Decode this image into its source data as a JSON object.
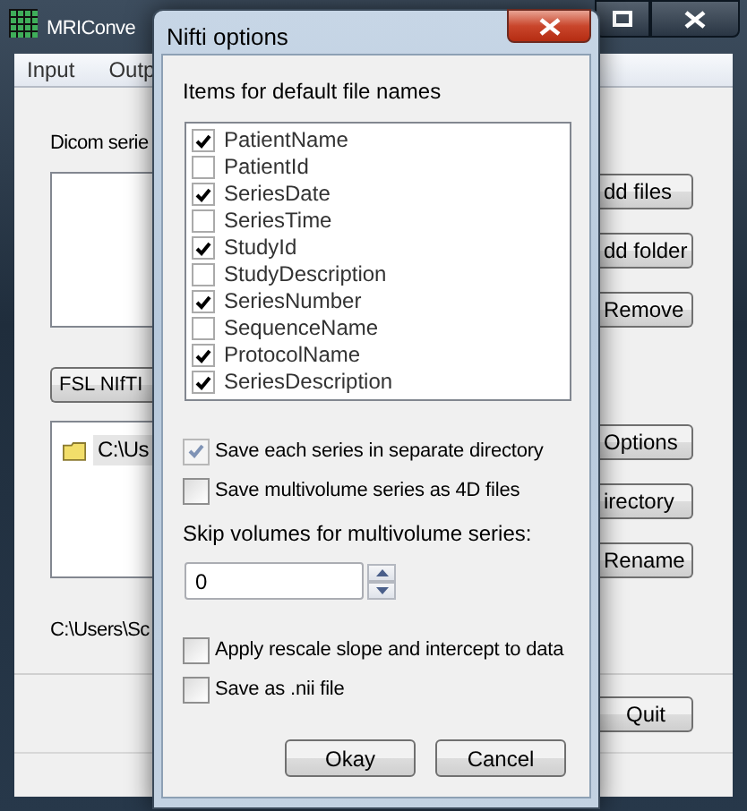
{
  "main_window": {
    "title": "MRIConve",
    "menu": [
      "Input",
      "Outp"
    ],
    "dicom_label": "Dicom serie",
    "side_buttons": [
      "dd files",
      "dd folder",
      "Remove",
      "Options",
      "irectory",
      "Rename"
    ],
    "format_combo": "FSL NIfTI",
    "tree": [
      {
        "label": "C:\\Us"
      }
    ],
    "path": "C:\\Users\\Sc",
    "quit_button": "Quit"
  },
  "dialog": {
    "title": "Nifti options",
    "items_label": "Items for default file names",
    "items": [
      {
        "label": "PatientName",
        "checked": true
      },
      {
        "label": "PatientId",
        "checked": false
      },
      {
        "label": "SeriesDate",
        "checked": true
      },
      {
        "label": "SeriesTime",
        "checked": false
      },
      {
        "label": "StudyId",
        "checked": true
      },
      {
        "label": "StudyDescription",
        "checked": false
      },
      {
        "label": "SeriesNumber",
        "checked": true
      },
      {
        "label": "SequenceName",
        "checked": false
      },
      {
        "label": "ProtocolName",
        "checked": true
      },
      {
        "label": "SeriesDescription",
        "checked": true
      }
    ],
    "options_top": [
      {
        "label": "Save each series in separate directory",
        "checked": true,
        "disabled": true
      },
      {
        "label": "Save multivolume series as 4D files",
        "checked": false,
        "disabled": false
      }
    ],
    "skip_label": "Skip volumes for multivolume series:",
    "skip_value": "0",
    "options_bottom": [
      {
        "label": "Apply rescale slope and intercept to data",
        "checked": false,
        "disabled": false
      },
      {
        "label": "Save as .nii file",
        "checked": false,
        "disabled": false
      }
    ],
    "buttons": [
      "Okay",
      "Cancel"
    ]
  }
}
